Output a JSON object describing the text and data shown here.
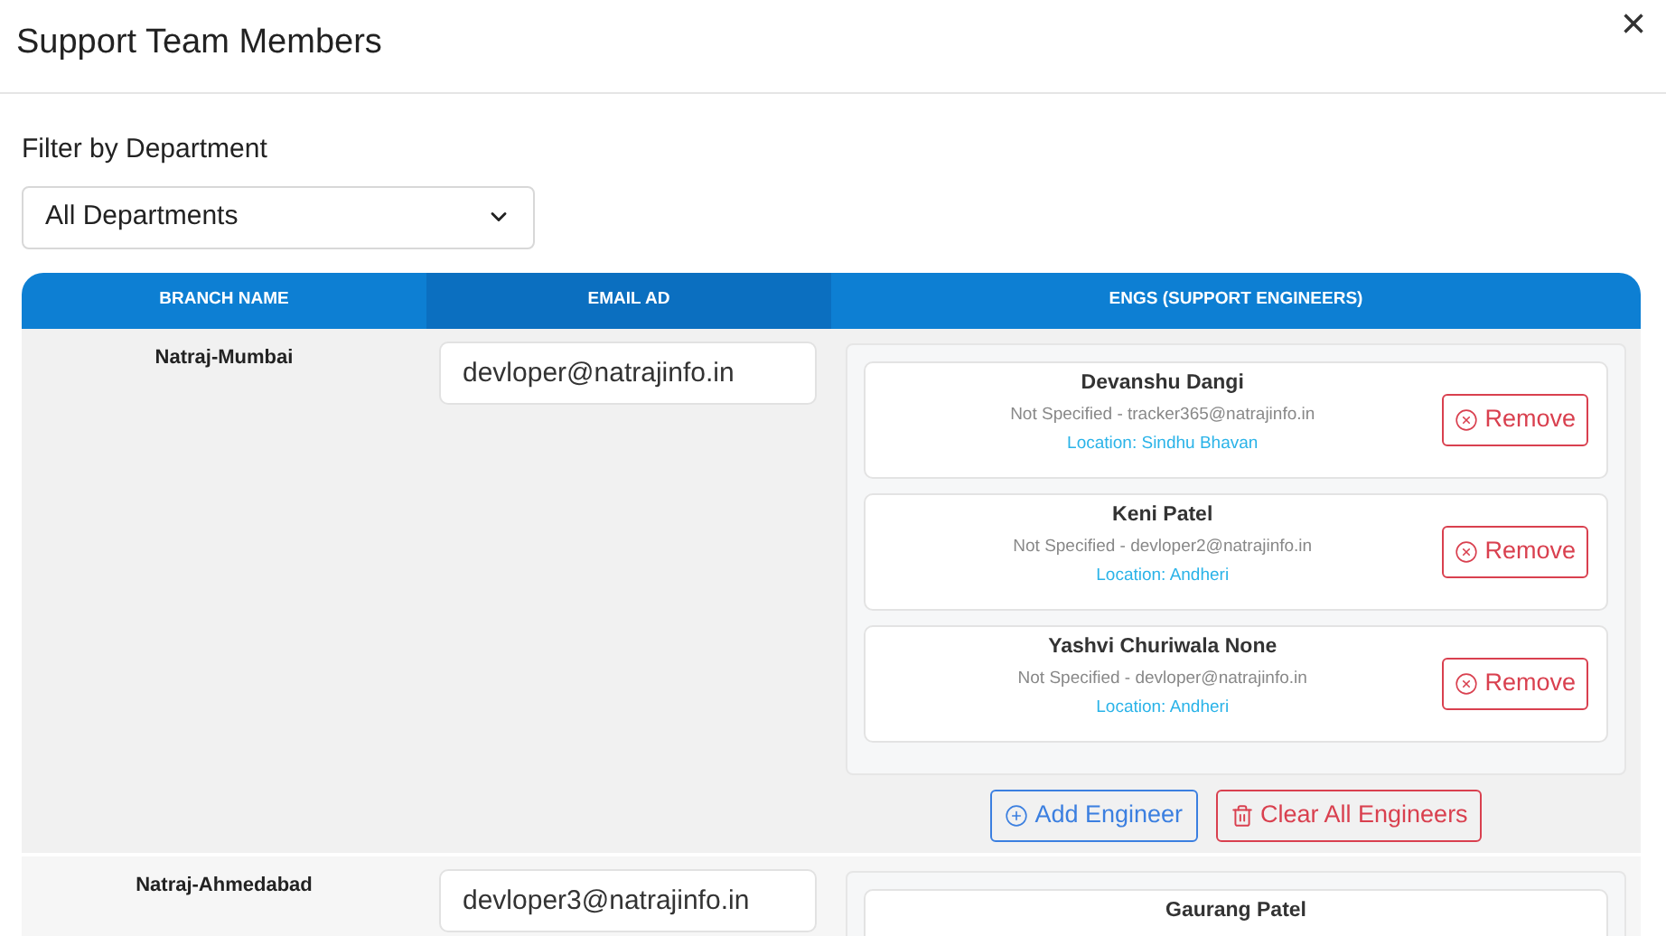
{
  "dialog": {
    "title": "Support Team Members",
    "close": "×"
  },
  "filter": {
    "label": "Filter by Department",
    "value": "All Departments"
  },
  "table": {
    "columns": [
      "BRANCH NAME",
      "EMAIL AD",
      "ENGS (SUPPORT ENGINEERS)"
    ],
    "rows": [
      {
        "branch": "Natraj-Mumbai",
        "email": "devloper@natrajinfo.in",
        "engineers": [
          {
            "name": "Devanshu Dangi",
            "detail": "Not Specified - tracker365@natrajinfo.in",
            "location": "Location: Sindhu Bhavan",
            "action": "Remove"
          },
          {
            "name": "Keni Patel",
            "detail": "Not Specified - devloper2@natrajinfo.in",
            "location": "Location: Andheri",
            "action": "Remove"
          },
          {
            "name": "Yashvi Churiwala None",
            "detail": "Not Specified - devloper@natrajinfo.in",
            "location": "Location: Andheri",
            "action": "Remove"
          }
        ],
        "add": "Add Engineer",
        "clear": "Clear All Engineers"
      },
      {
        "branch": "Natraj-Ahmedabad",
        "email": "devloper3@natrajinfo.in",
        "engineers": [
          {
            "name": "Gaurang Patel"
          }
        ]
      }
    ]
  }
}
